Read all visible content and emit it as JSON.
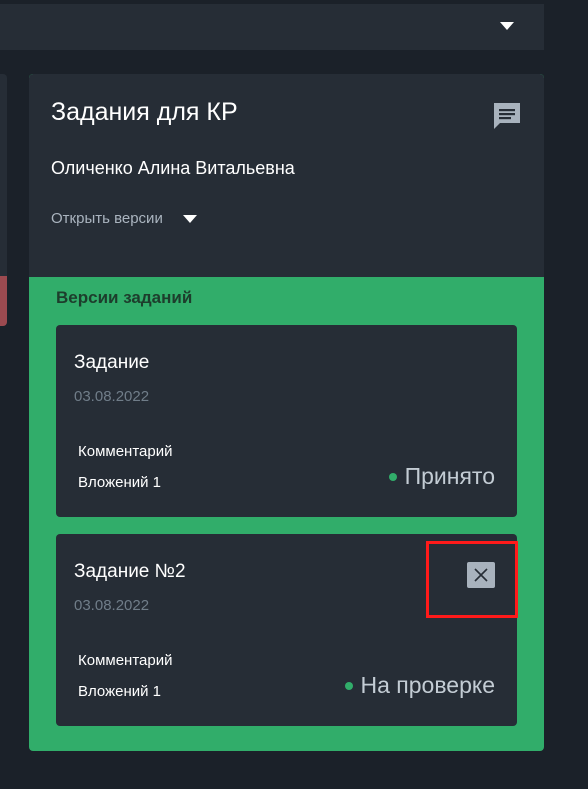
{
  "colors": {
    "background": "#1b2129",
    "panel": "#262d36",
    "accent_green": "#31ad6a",
    "highlight_red": "#ff1a1a"
  },
  "card": {
    "title": "Задания для КР",
    "student_name": "Оличенко Алина Витальевна",
    "open_versions_label": "Открыть версии",
    "section_title": "Версии заданий",
    "versions": [
      {
        "title": "Задание",
        "date": "03.08.2022",
        "comment_label": "Комментарий",
        "attachments_label": "Вложений 1",
        "status": "Принято",
        "status_color": "#31ad6a"
      },
      {
        "title": "Задание №2",
        "date": "03.08.2022",
        "comment_label": "Комментарий",
        "attachments_label": "Вложений 1",
        "status": "На проверке",
        "status_color": "#31ad6a",
        "delete_icon": "close-icon"
      }
    ]
  },
  "icons": {
    "chat": "chat-icon",
    "dropdown": "chevron-down-icon",
    "delete": "close-icon"
  }
}
